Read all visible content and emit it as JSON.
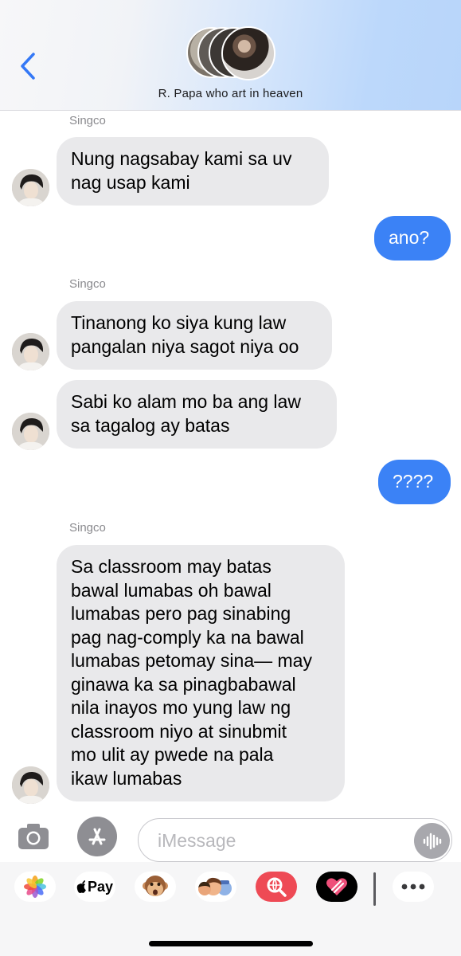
{
  "header": {
    "title": "R. Papa who art in heaven",
    "back_icon": "chevron-left-icon",
    "accent_color": "#3478f6"
  },
  "messages": [
    {
      "type": "sender",
      "text": "Singco"
    },
    {
      "type": "incoming",
      "text": "Nung nagsabay kami sa uv\nnag usap kami"
    },
    {
      "type": "outgoing",
      "text": "ano?"
    },
    {
      "type": "sender",
      "text": "Singco"
    },
    {
      "type": "incoming",
      "text": "Tinanong ko siya kung law\npangalan niya sagot niya oo"
    },
    {
      "type": "incoming",
      "text": "Sabi ko alam mo ba ang law\nsa tagalog ay batas"
    },
    {
      "type": "outgoing",
      "text": "????"
    },
    {
      "type": "sender",
      "text": "Singco"
    },
    {
      "type": "incoming",
      "text": "Sa classroom may batas\nbawal lumabas oh bawal\nlumabas pero pag sinabing\npag nag-comply ka na bawal\nlumabas petomay sina— may\nginawa ka sa pinagbabawal\nnila inayos mo yung law ng\nclassroom niyo at sinubmit\nmo ulit ay pwede na pala\nikaw lumabas"
    }
  ],
  "colors": {
    "incoming_bubble": "#e9e9eb",
    "outgoing_bubble": "#3b82f6"
  },
  "input_bar": {
    "placeholder": "iMessage",
    "camera_icon": "camera-icon",
    "apps_icon": "app-store-icon",
    "voice_icon": "waveform-icon"
  },
  "app_drawer": {
    "apps": [
      {
        "name": "photos-icon"
      },
      {
        "name": "apple-pay-icon",
        "label": "Pay"
      },
      {
        "name": "monkey-memoji-icon"
      },
      {
        "name": "memoji-stickers-icon"
      },
      {
        "name": "image-search-icon"
      },
      {
        "name": "digital-touch-icon"
      },
      {
        "name": "more-icon"
      }
    ]
  }
}
